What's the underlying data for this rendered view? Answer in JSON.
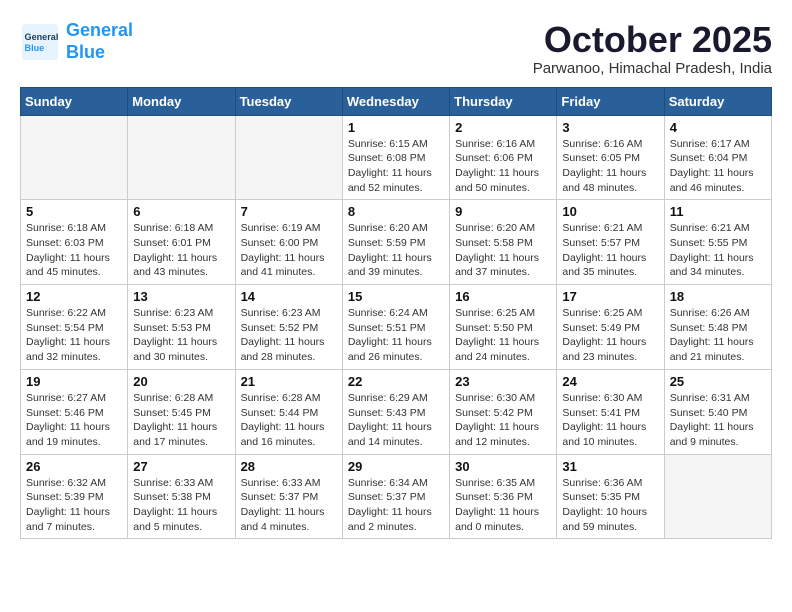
{
  "logo": {
    "line1": "General",
    "line2": "Blue"
  },
  "title": "October 2025",
  "location": "Parwanoo, Himachal Pradesh, India",
  "days_of_week": [
    "Sunday",
    "Monday",
    "Tuesday",
    "Wednesday",
    "Thursday",
    "Friday",
    "Saturday"
  ],
  "weeks": [
    [
      {
        "day": "",
        "info": ""
      },
      {
        "day": "",
        "info": ""
      },
      {
        "day": "",
        "info": ""
      },
      {
        "day": "1",
        "info": "Sunrise: 6:15 AM\nSunset: 6:08 PM\nDaylight: 11 hours\nand 52 minutes."
      },
      {
        "day": "2",
        "info": "Sunrise: 6:16 AM\nSunset: 6:06 PM\nDaylight: 11 hours\nand 50 minutes."
      },
      {
        "day": "3",
        "info": "Sunrise: 6:16 AM\nSunset: 6:05 PM\nDaylight: 11 hours\nand 48 minutes."
      },
      {
        "day": "4",
        "info": "Sunrise: 6:17 AM\nSunset: 6:04 PM\nDaylight: 11 hours\nand 46 minutes."
      }
    ],
    [
      {
        "day": "5",
        "info": "Sunrise: 6:18 AM\nSunset: 6:03 PM\nDaylight: 11 hours\nand 45 minutes."
      },
      {
        "day": "6",
        "info": "Sunrise: 6:18 AM\nSunset: 6:01 PM\nDaylight: 11 hours\nand 43 minutes."
      },
      {
        "day": "7",
        "info": "Sunrise: 6:19 AM\nSunset: 6:00 PM\nDaylight: 11 hours\nand 41 minutes."
      },
      {
        "day": "8",
        "info": "Sunrise: 6:20 AM\nSunset: 5:59 PM\nDaylight: 11 hours\nand 39 minutes."
      },
      {
        "day": "9",
        "info": "Sunrise: 6:20 AM\nSunset: 5:58 PM\nDaylight: 11 hours\nand 37 minutes."
      },
      {
        "day": "10",
        "info": "Sunrise: 6:21 AM\nSunset: 5:57 PM\nDaylight: 11 hours\nand 35 minutes."
      },
      {
        "day": "11",
        "info": "Sunrise: 6:21 AM\nSunset: 5:55 PM\nDaylight: 11 hours\nand 34 minutes."
      }
    ],
    [
      {
        "day": "12",
        "info": "Sunrise: 6:22 AM\nSunset: 5:54 PM\nDaylight: 11 hours\nand 32 minutes."
      },
      {
        "day": "13",
        "info": "Sunrise: 6:23 AM\nSunset: 5:53 PM\nDaylight: 11 hours\nand 30 minutes."
      },
      {
        "day": "14",
        "info": "Sunrise: 6:23 AM\nSunset: 5:52 PM\nDaylight: 11 hours\nand 28 minutes."
      },
      {
        "day": "15",
        "info": "Sunrise: 6:24 AM\nSunset: 5:51 PM\nDaylight: 11 hours\nand 26 minutes."
      },
      {
        "day": "16",
        "info": "Sunrise: 6:25 AM\nSunset: 5:50 PM\nDaylight: 11 hours\nand 24 minutes."
      },
      {
        "day": "17",
        "info": "Sunrise: 6:25 AM\nSunset: 5:49 PM\nDaylight: 11 hours\nand 23 minutes."
      },
      {
        "day": "18",
        "info": "Sunrise: 6:26 AM\nSunset: 5:48 PM\nDaylight: 11 hours\nand 21 minutes."
      }
    ],
    [
      {
        "day": "19",
        "info": "Sunrise: 6:27 AM\nSunset: 5:46 PM\nDaylight: 11 hours\nand 19 minutes."
      },
      {
        "day": "20",
        "info": "Sunrise: 6:28 AM\nSunset: 5:45 PM\nDaylight: 11 hours\nand 17 minutes."
      },
      {
        "day": "21",
        "info": "Sunrise: 6:28 AM\nSunset: 5:44 PM\nDaylight: 11 hours\nand 16 minutes."
      },
      {
        "day": "22",
        "info": "Sunrise: 6:29 AM\nSunset: 5:43 PM\nDaylight: 11 hours\nand 14 minutes."
      },
      {
        "day": "23",
        "info": "Sunrise: 6:30 AM\nSunset: 5:42 PM\nDaylight: 11 hours\nand 12 minutes."
      },
      {
        "day": "24",
        "info": "Sunrise: 6:30 AM\nSunset: 5:41 PM\nDaylight: 11 hours\nand 10 minutes."
      },
      {
        "day": "25",
        "info": "Sunrise: 6:31 AM\nSunset: 5:40 PM\nDaylight: 11 hours\nand 9 minutes."
      }
    ],
    [
      {
        "day": "26",
        "info": "Sunrise: 6:32 AM\nSunset: 5:39 PM\nDaylight: 11 hours\nand 7 minutes."
      },
      {
        "day": "27",
        "info": "Sunrise: 6:33 AM\nSunset: 5:38 PM\nDaylight: 11 hours\nand 5 minutes."
      },
      {
        "day": "28",
        "info": "Sunrise: 6:33 AM\nSunset: 5:37 PM\nDaylight: 11 hours\nand 4 minutes."
      },
      {
        "day": "29",
        "info": "Sunrise: 6:34 AM\nSunset: 5:37 PM\nDaylight: 11 hours\nand 2 minutes."
      },
      {
        "day": "30",
        "info": "Sunrise: 6:35 AM\nSunset: 5:36 PM\nDaylight: 11 hours\nand 0 minutes."
      },
      {
        "day": "31",
        "info": "Sunrise: 6:36 AM\nSunset: 5:35 PM\nDaylight: 10 hours\nand 59 minutes."
      },
      {
        "day": "",
        "info": ""
      }
    ]
  ]
}
